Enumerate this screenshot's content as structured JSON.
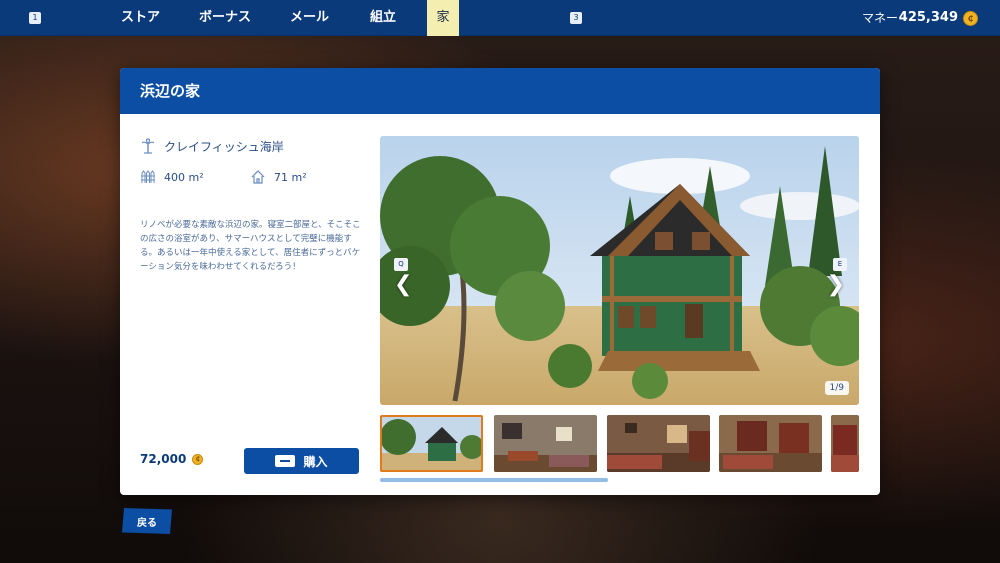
{
  "topbar": {
    "left_key": "1",
    "right_key": "3",
    "tabs": [
      {
        "label": "ストア"
      },
      {
        "label": "ボーナス"
      },
      {
        "label": "メール"
      },
      {
        "label": "組立"
      },
      {
        "label": "家",
        "active": true
      }
    ],
    "money_label": "マネー",
    "money_value": "425,349"
  },
  "modal": {
    "title": "浜辺の家",
    "location": "クレイフィッシュ海岸",
    "plot_area": "400 m²",
    "house_area": "71 m²",
    "description": "リノベが必要な素敵な浜辺の家。寝室二部屋と、そこそこの広さの浴室があり、サマーハウスとして完璧に機能する。あるいは一年中使える家として、居住者にずっとバケーション気分を味わわせてくれるだろう！",
    "price": "72,000",
    "buy_label": "購入",
    "gallery": {
      "prev_key": "Q",
      "next_key": "E",
      "counter": "1/9",
      "thumbnails": [
        {
          "name": "exterior",
          "selected": true
        },
        {
          "name": "living-room"
        },
        {
          "name": "bedroom"
        },
        {
          "name": "bedroom-2"
        },
        {
          "name": "interior-partial"
        }
      ]
    }
  },
  "back_label": "戻る",
  "colors": {
    "nav": "#0b3a7a",
    "accent_blue": "#0b4ea3",
    "active_tab": "#f4efb0",
    "coin": "#f0b323",
    "thumb_selected": "#e07a1a"
  }
}
